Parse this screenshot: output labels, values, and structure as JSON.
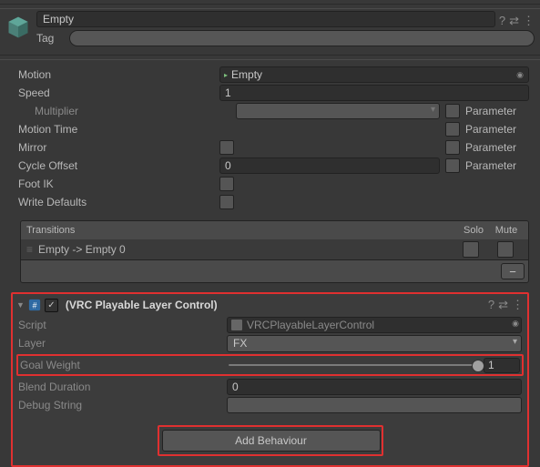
{
  "header": {
    "name": "Empty",
    "tag_label": "Tag"
  },
  "state": {
    "motion_label": "Motion",
    "motion_value": "Empty",
    "speed_label": "Speed",
    "speed_value": "1",
    "multiplier_label": "Multiplier",
    "motion_time_label": "Motion Time",
    "mirror_label": "Mirror",
    "cycle_offset_label": "Cycle Offset",
    "cycle_offset_value": "0",
    "foot_ik_label": "Foot IK",
    "write_defaults_label": "Write Defaults",
    "parameter_label": "Parameter"
  },
  "transitions": {
    "title": "Transitions",
    "col_solo": "Solo",
    "col_mute": "Mute",
    "items": [
      {
        "label": "Empty -> Empty 0"
      }
    ]
  },
  "component": {
    "title": "(VRC Playable Layer Control)",
    "script_label": "Script",
    "script_value": "VRCPlayableLayerControl",
    "layer_label": "Layer",
    "layer_value": "FX",
    "goal_weight_label": "Goal Weight",
    "goal_weight_value": "1",
    "goal_weight_norm": 1.0,
    "blend_duration_label": "Blend Duration",
    "blend_duration_value": "0",
    "debug_string_label": "Debug String",
    "add_behaviour_label": "Add Behaviour"
  }
}
